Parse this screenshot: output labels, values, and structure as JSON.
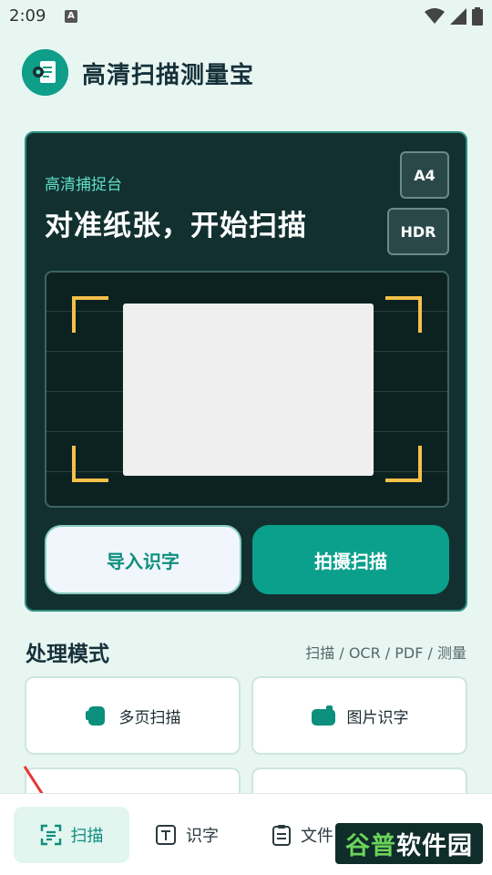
{
  "status_bar": {
    "time": "2:09",
    "a_badge": "A"
  },
  "header": {
    "title": "高清扫描测量宝",
    "logo_icon": "document-scan-icon"
  },
  "capture": {
    "subtitle": "高清捕捉台",
    "headline": "对准纸张，开始扫描",
    "chips": [
      "A4",
      "HDR"
    ],
    "import_button": "导入识字",
    "capture_button": "拍摄扫描"
  },
  "section": {
    "title": "处理模式",
    "hint": "扫描 / OCR / PDF / 测量"
  },
  "modes": [
    {
      "label": "多页扫描",
      "icon": "multi-page-icon"
    },
    {
      "label": "图片识字",
      "icon": "image-text-icon"
    },
    {
      "label": "",
      "icon": ""
    },
    {
      "label": "",
      "icon": ""
    }
  ],
  "nav": [
    {
      "label": "扫描",
      "icon": "scan-icon",
      "active": true
    },
    {
      "label": "识字",
      "icon": "text-icon"
    },
    {
      "label": "文件",
      "icon": "clipboard-icon"
    },
    {
      "label": "",
      "icon": "more-icon"
    }
  ],
  "watermark": {
    "part_a": "谷普",
    "part_b": "软件园"
  },
  "colors": {
    "accent": "#0aa08c",
    "card_dark": "#12302f",
    "corner": "#f4c049",
    "background": "#e8f6f1"
  }
}
